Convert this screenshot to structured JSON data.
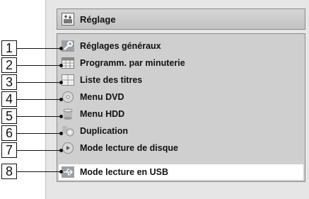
{
  "header": {
    "title": "Réglage",
    "icon": "settings-panel-icon"
  },
  "menu": {
    "items": [
      {
        "label": "Réglages généraux",
        "icon": "wrench-icon"
      },
      {
        "label": "Programm. par minuterie",
        "icon": "timer-grid-icon"
      },
      {
        "label": "Liste des titres",
        "icon": "title-list-icon"
      },
      {
        "label": "Menu DVD",
        "icon": "dvd-disc-icon"
      },
      {
        "label": "Menu HDD",
        "icon": "hdd-cylinder-icon"
      },
      {
        "label": "Duplication",
        "icon": "duplication-icon"
      },
      {
        "label": "Mode lecture de disque",
        "icon": "disc-playback-icon"
      },
      {
        "label": "Mode lecture en USB",
        "icon": "usb-icon"
      }
    ],
    "selected_index": 7
  },
  "callouts": [
    "1",
    "2",
    "3",
    "4",
    "5",
    "6",
    "7",
    "8"
  ]
}
